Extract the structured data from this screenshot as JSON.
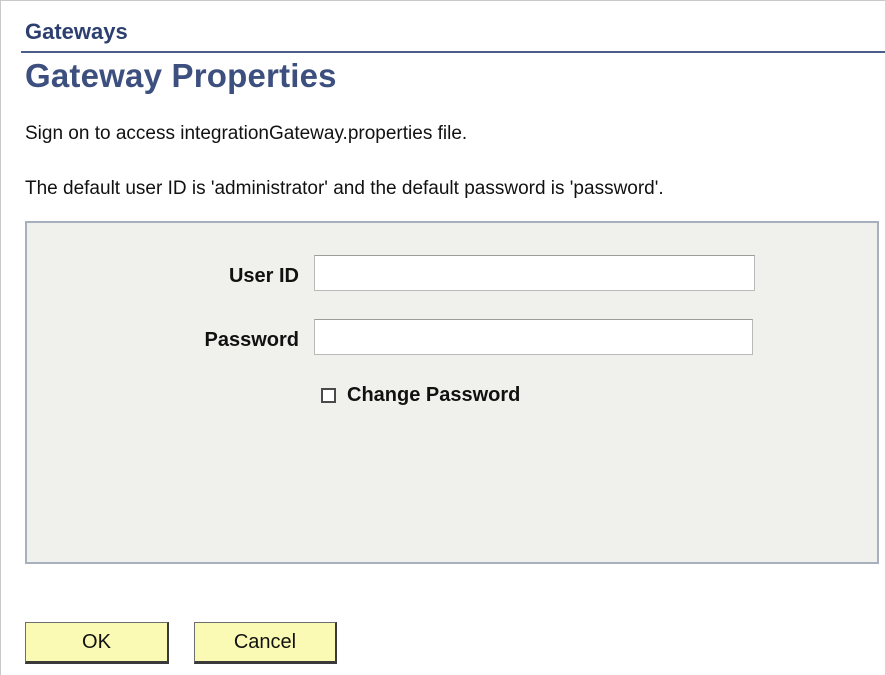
{
  "header": {
    "breadcrumb": "Gateways",
    "title": "Gateway Properties"
  },
  "info": {
    "line1": "Sign on to access integrationGateway.properties file.",
    "line2": "The default user ID is 'administrator' and the default password is 'password'."
  },
  "form": {
    "user_id_label": "User ID",
    "user_id_value": "",
    "password_label": "Password",
    "password_value": "",
    "change_password_label": "Change Password",
    "change_password_checked": false
  },
  "buttons": {
    "ok_label": "OK",
    "cancel_label": "Cancel"
  },
  "colors": {
    "heading": "#3c4f7e",
    "panel_background": "#f0f1ec",
    "button_background": "#fafab4"
  }
}
